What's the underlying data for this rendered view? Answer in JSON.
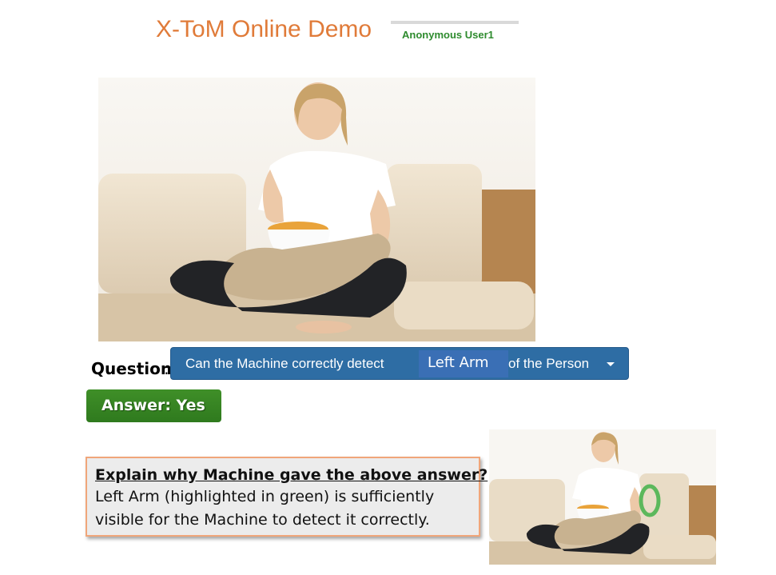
{
  "header": {
    "title": "X-ToM Online Demo",
    "user": "Anonymous User1"
  },
  "question": {
    "label": "Question",
    "colon": ":",
    "prefix": "Can the Machine correctly detect",
    "selected_part": "Left Arm",
    "suffix": "of the Person"
  },
  "answer": {
    "label": "Answer: Yes"
  },
  "explanation": {
    "title": "Explain why Machine gave the above answer?",
    "text": "Left Arm (highlighted in green) is sufficiently visible for the Machine to detect it correctly."
  },
  "colors": {
    "title": "#e07b39",
    "dropdown": "#2e6da4",
    "answer": "#3a8a24",
    "highlight": "#5cb85c",
    "box_border": "#f0a67a"
  },
  "icons": {
    "dropdown_caret": "caret-down-icon"
  }
}
